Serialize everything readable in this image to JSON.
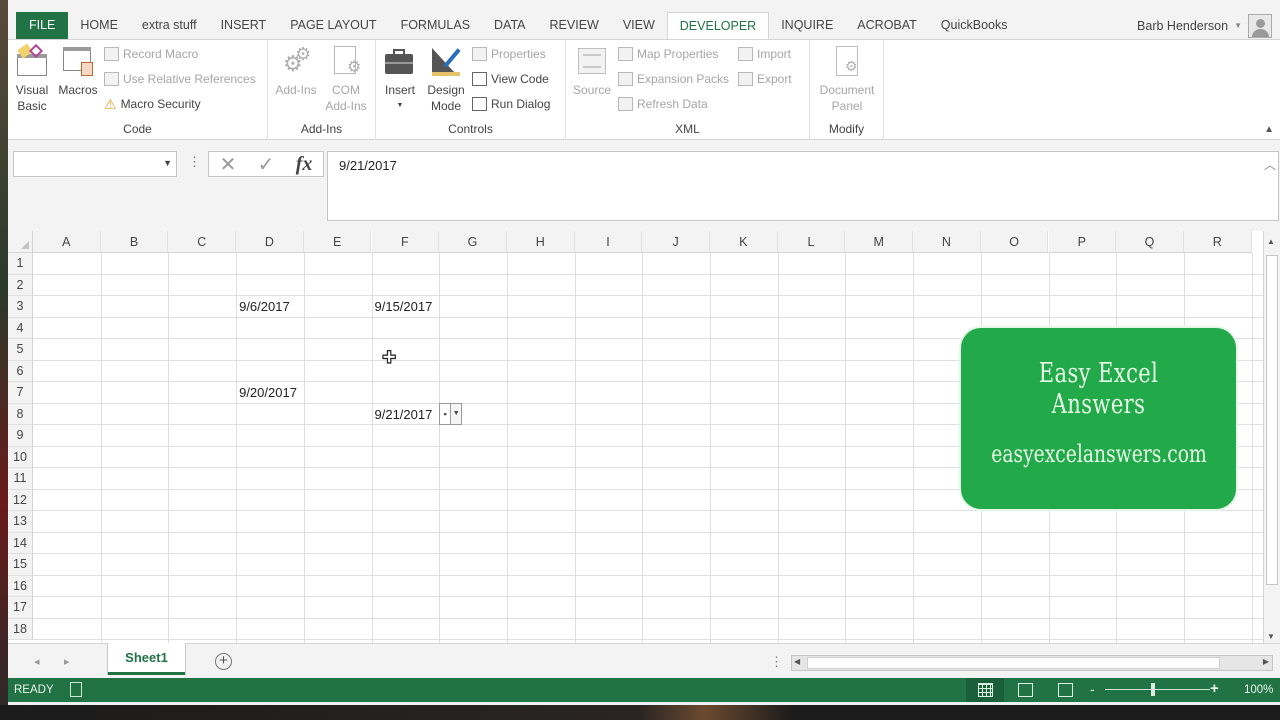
{
  "ribbon": {
    "tabs": [
      "FILE",
      "HOME",
      "extra stuff",
      "INSERT",
      "PAGE LAYOUT",
      "FORMULAS",
      "DATA",
      "REVIEW",
      "VIEW",
      "DEVELOPER",
      "INQUIRE",
      "ACROBAT",
      "QuickBooks"
    ],
    "active_tab": "DEVELOPER",
    "user_name": "Barb Henderson",
    "groups": {
      "code": {
        "label": "Code",
        "visual_basic": "Visual Basic",
        "visual_basic_l1": "Visual",
        "visual_basic_l2": "Basic",
        "macros": "Macros",
        "record_macro": "Record Macro",
        "use_relative": "Use Relative References",
        "macro_security": "Macro Security"
      },
      "addins": {
        "label": "Add-Ins",
        "addins": "Add-Ins",
        "com_l1": "COM",
        "com_l2": "Add-Ins"
      },
      "controls": {
        "label": "Controls",
        "insert": "Insert",
        "design_l1": "Design",
        "design_l2": "Mode",
        "properties": "Properties",
        "view_code": "View Code",
        "run_dialog": "Run Dialog"
      },
      "xml": {
        "label": "XML",
        "source": "Source",
        "map_properties": "Map Properties",
        "expansion_packs": "Expansion Packs",
        "refresh_data": "Refresh Data",
        "import": "Import",
        "export": "Export"
      },
      "modify": {
        "label": "Modify",
        "doc_l1": "Document",
        "doc_l2": "Panel"
      }
    }
  },
  "formula_bar": {
    "name_box": "",
    "cancel_icon": "✕",
    "enter_icon": "✓",
    "fx_label": "fx",
    "value": "9/21/2017"
  },
  "grid": {
    "columns": [
      "A",
      "B",
      "C",
      "D",
      "E",
      "F",
      "G",
      "H",
      "I",
      "J",
      "K",
      "L",
      "M",
      "N",
      "O",
      "P",
      "Q",
      "R"
    ],
    "rows": [
      "1",
      "2",
      "3",
      "4",
      "5",
      "6",
      "7",
      "8",
      "9",
      "10",
      "11",
      "12",
      "13",
      "14",
      "15",
      "16",
      "17",
      "18"
    ],
    "cells": [
      {
        "ref": "D3",
        "value": "9/6/2017"
      },
      {
        "ref": "F3",
        "value": "9/15/2017"
      },
      {
        "ref": "D7",
        "value": "9/20/2017"
      },
      {
        "ref": "F8",
        "value": "9/21/2017"
      }
    ]
  },
  "promo": {
    "title": "Easy Excel Answers",
    "url": "easyexcelanswers.com",
    "color": "#22a94a"
  },
  "sheets": {
    "tabs": [
      "Sheet1"
    ],
    "active": "Sheet1",
    "add_label": "+"
  },
  "status": {
    "mode": "READY",
    "zoom": "100%",
    "zoom_minus": "-",
    "zoom_plus": "+",
    "active_view": "normal"
  },
  "colors": {
    "excel_green": "#217346",
    "status_bar": "#217346"
  }
}
